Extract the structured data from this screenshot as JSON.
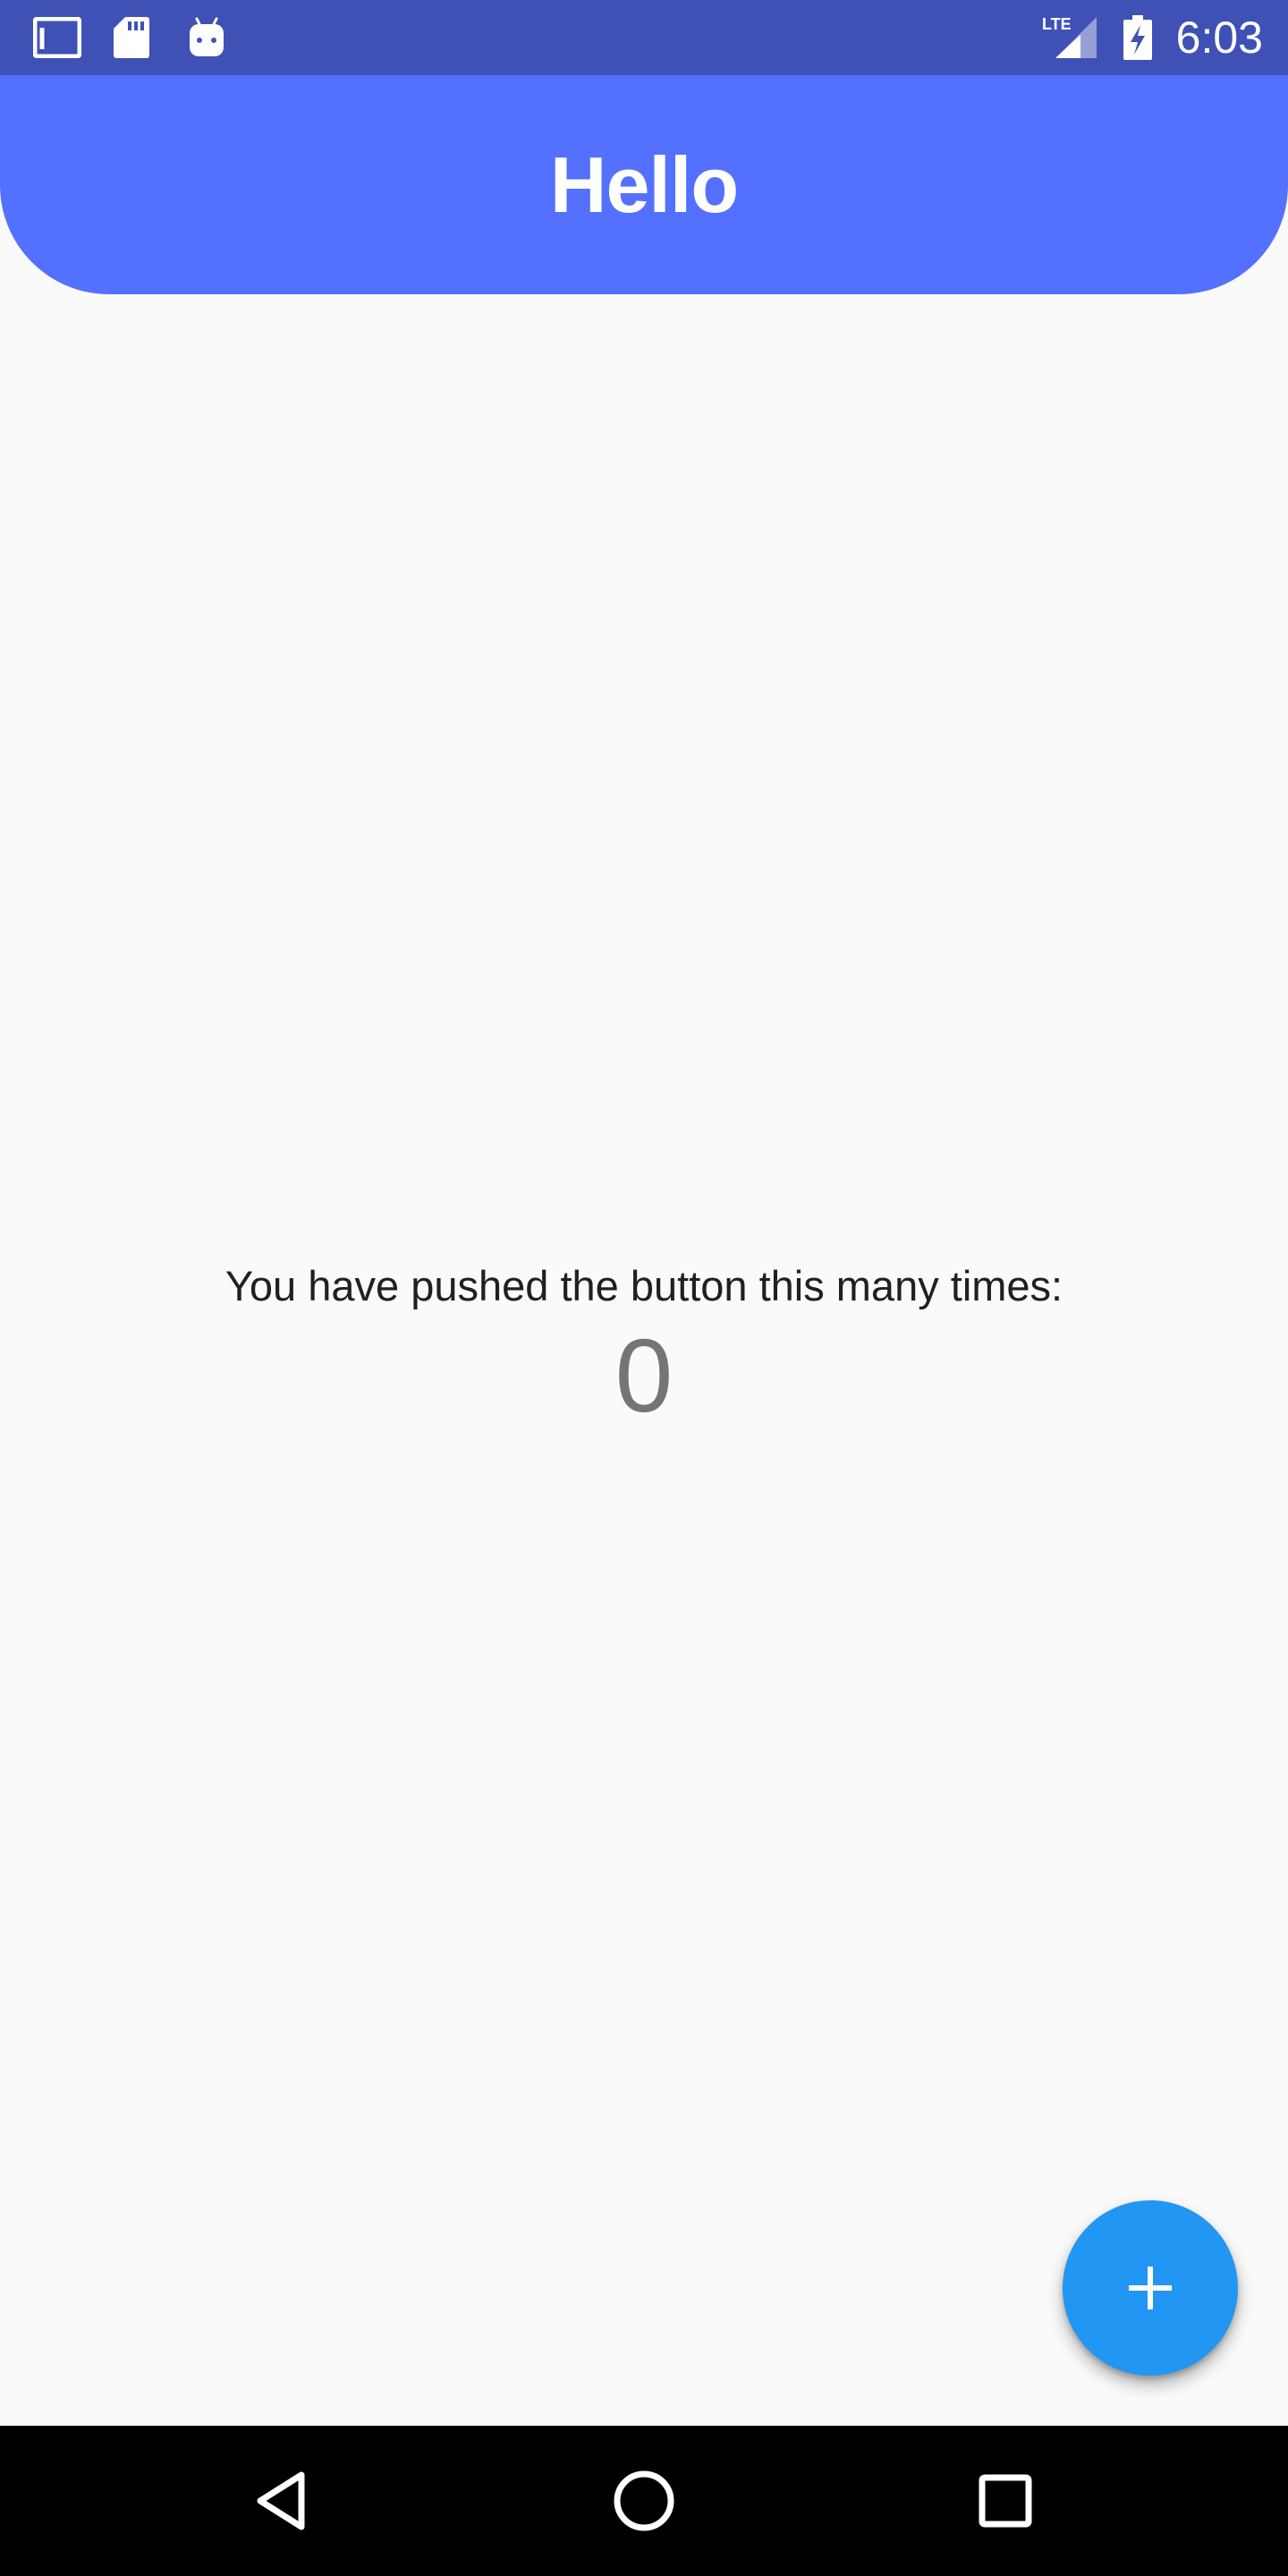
{
  "status_bar": {
    "time": "6:03",
    "network": "LTE",
    "icons": [
      "gmail-icon",
      "sd-card-icon",
      "android-icon",
      "lte-signal-icon",
      "battery-charging-icon"
    ],
    "background": "#3f51b5"
  },
  "app_bar": {
    "title": "Hello",
    "background": "#5470ff"
  },
  "content": {
    "counter_label": "You have pushed the button this many times:",
    "counter_value": "0"
  },
  "fab": {
    "icon": "add-icon",
    "color": "#2196f3"
  },
  "nav_bar": {
    "buttons": [
      "back-icon",
      "home-icon",
      "recents-icon"
    ]
  }
}
